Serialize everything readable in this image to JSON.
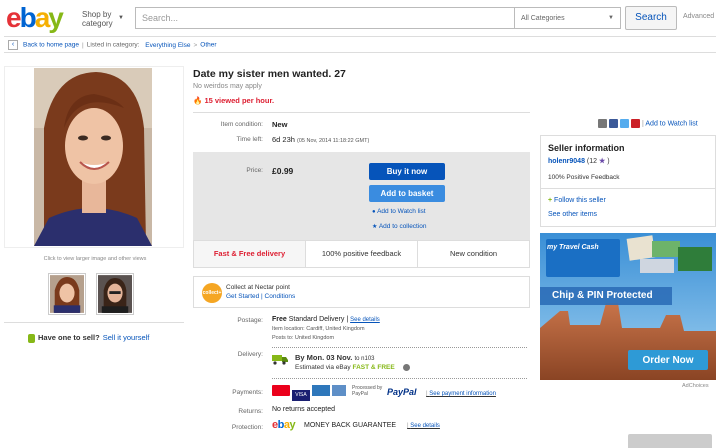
{
  "header": {
    "logo": {
      "e": "e",
      "b": "b",
      "a": "a",
      "y": "y"
    },
    "shop_by_1": "Shop by",
    "shop_by_2": "category",
    "search_placeholder": "Search...",
    "category_select": "All Categories",
    "search_button": "Search",
    "advanced": "Advanced"
  },
  "breadcrumb": {
    "back": "Back to home page",
    "listed_in": "Listed in category:",
    "cat1": "Everything Else",
    "cat2": "Other"
  },
  "gallery": {
    "caption": "Click to view larger image and other views"
  },
  "sell": {
    "question": "Have one to sell?",
    "link": "Sell it yourself"
  },
  "item": {
    "title": "Date my sister men wanted. 27",
    "subtitle": "No weirdos may apply",
    "viewed": "15 viewed per hour.",
    "condition_label": "Item condition:",
    "condition_value": "New",
    "time_label": "Time left:",
    "time_value": "6d 23h",
    "time_detail": "(05 Nov, 2014  11:18:22 GMT)",
    "price_label": "Price:",
    "price_value": "£0.99",
    "buy_now": "Buy it now",
    "add_basket": "Add to basket",
    "add_watch": "Add to Watch list",
    "add_collection": "Add to collection",
    "watch_list_link": "Add to Watch list"
  },
  "badges": {
    "fast": "Fast & Free delivery",
    "positive": "100% positive feedback",
    "new_condition": "New condition"
  },
  "collect": {
    "logo_text": "collect+",
    "line1": "Collect at Nectar point",
    "line2": "Get Started | Conditions"
  },
  "shipping": {
    "postage_label": "Postage:",
    "postage_value": "Free",
    "postage_type": "Standard Delivery",
    "see_details": "See details",
    "item_location": "Item location: Cardiff, United Kingdom",
    "posts_to": "Posts to: United Kingdom",
    "delivery_label": "Delivery:",
    "delivery_by": "By Mon. 03 Nov.",
    "delivery_to": "to n103",
    "estimated": "Estimated via eBay",
    "fast_free": "FAST & FREE",
    "payments_label": "Payments:",
    "paypal": "PayPal",
    "processed": "Processed by PayPal",
    "see_payment": "See payment information",
    "returns_label": "Returns:",
    "returns_value": "No returns accepted",
    "protection_label": "Protection:",
    "protection_value": "MONEY BACK GUARANTEE",
    "protection_link": "See details"
  },
  "seller": {
    "heading": "Seller information",
    "name": "holenr9048",
    "score": "(12",
    "score_end": ")",
    "feedback": "100% Positive Feedback",
    "follow": "Follow this seller",
    "other_items": "See other items"
  },
  "ad": {
    "brand": "my Travel Cash",
    "banner": "Chip & PIN Protected",
    "cta": "Order Now",
    "choices": "AdChoices"
  },
  "colors": {
    "ebay_red": "#e53238",
    "ebay_blue": "#0064d2",
    "ebay_yellow": "#f5af02",
    "ebay_green": "#86b817",
    "link": "#0654ba",
    "buy_btn": "#0654ba",
    "ad_cta": "#2e9ad6"
  }
}
